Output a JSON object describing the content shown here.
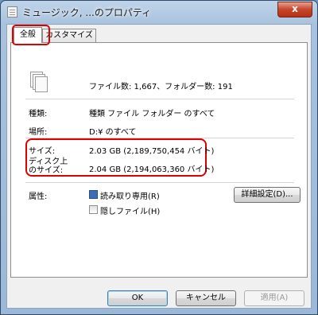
{
  "window": {
    "title": "ミュージック, ...のプロパティ",
    "close_label": "x"
  },
  "tabs": [
    {
      "label": "全般",
      "active": true
    },
    {
      "label": "カスタマイズ",
      "active": false
    }
  ],
  "general": {
    "file_count": "ファイル数: 1,667、フォルダー数: 191",
    "type_label": "種類:",
    "type_value": "種類 ファイル フォルダー のすべて",
    "location_label": "場所:",
    "location_value": "D:¥ のすべて",
    "size_label": "サイズ:",
    "size_value": "2.03 GB (2,189,750,454 バイト)",
    "disk_size_label_line1": "ディスク上",
    "disk_size_label_line2": "のサイズ:",
    "disk_size_value": "2.04 GB (2,194,063,360 バイト)",
    "attributes_label": "属性:",
    "readonly_label": "読み取り専用(R)",
    "hidden_label": "隠しファイル(H)",
    "advanced_button": "詳細設定(D)..."
  },
  "buttons": {
    "ok": "OK",
    "cancel": "キャンセル",
    "apply": "適用(A)"
  },
  "colors": {
    "highlight": "#e00000",
    "checkbox_checked": "#3a6fb8"
  }
}
